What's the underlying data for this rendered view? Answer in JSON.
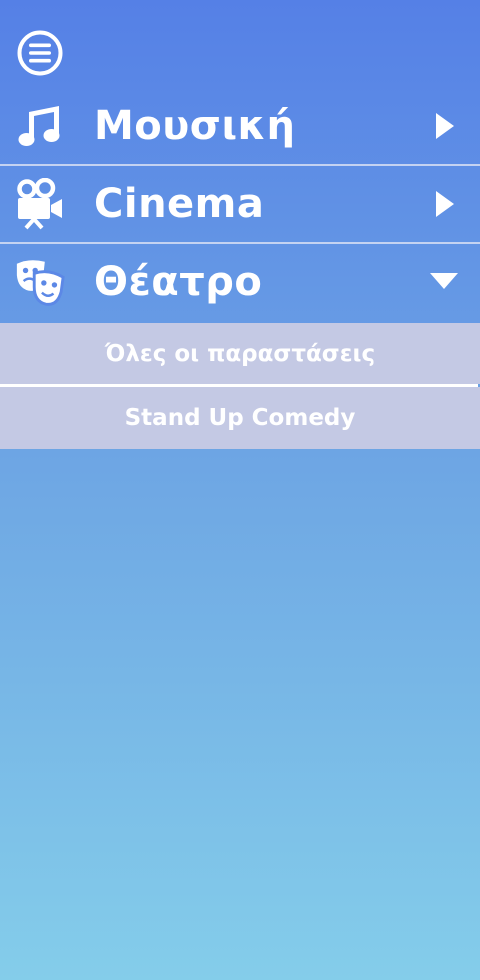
{
  "menu": {
    "toggle_icon": "hamburger-circle-icon"
  },
  "nav": {
    "items": [
      {
        "label": "Μουσική",
        "icon": "music-note-icon",
        "arrow": "chevron-right-icon",
        "expanded": false
      },
      {
        "label": "Cinema",
        "icon": "movie-camera-icon",
        "arrow": "chevron-right-icon",
        "expanded": false
      },
      {
        "label": "Θέατρο",
        "icon": "theater-masks-icon",
        "arrow": "chevron-down-icon",
        "expanded": true
      }
    ]
  },
  "submenu": {
    "items": [
      {
        "label": "Όλες οι παραστάσεις"
      },
      {
        "label": "Stand Up Comedy"
      }
    ]
  },
  "colors": {
    "gradient_top": "#5580e6",
    "gradient_bottom": "#84cdea",
    "submenu_bg": "#c4c9e4",
    "text": "#ffffff"
  }
}
